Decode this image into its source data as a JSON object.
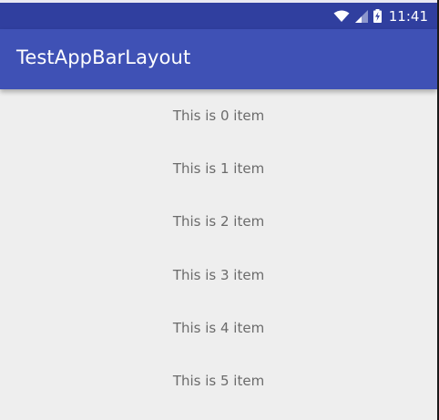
{
  "status_bar": {
    "time": "11:41",
    "icons": [
      "wifi-icon",
      "signal-icon",
      "battery-charging-icon"
    ],
    "color": "#303f9f"
  },
  "app_bar": {
    "title": "TestAppBarLayout",
    "color": "#3f51b5"
  },
  "list": {
    "items": [
      "This is 0 item",
      "This is 1 item",
      "This is 2 item",
      "This is 3 item",
      "This is 4 item",
      "This is 5 item"
    ]
  }
}
